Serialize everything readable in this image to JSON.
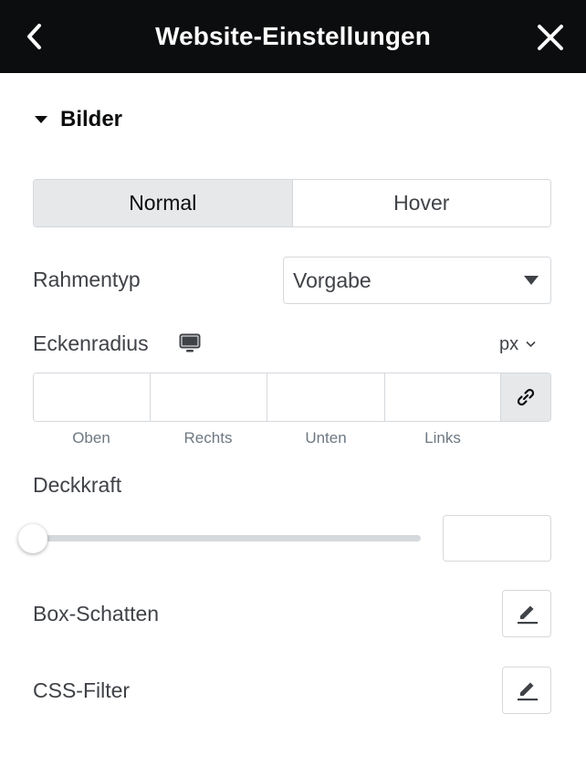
{
  "header": {
    "title": "Website-Einstellungen",
    "back_icon": "chevron-left-icon",
    "close_icon": "close-icon"
  },
  "section": {
    "title": "Bilder",
    "expanded": true
  },
  "tabs": [
    {
      "label": "Normal",
      "active": true
    },
    {
      "label": "Hover",
      "active": false
    }
  ],
  "border_type": {
    "label": "Rahmentyp",
    "value": "Vorgabe"
  },
  "corner_radius": {
    "label": "Eckenradius",
    "device_icon": "desktop-monitor-icon",
    "unit": "px",
    "fields": [
      {
        "label": "Oben",
        "value": ""
      },
      {
        "label": "Rechts",
        "value": ""
      },
      {
        "label": "Unten",
        "value": ""
      },
      {
        "label": "Links",
        "value": ""
      }
    ],
    "link_icon": "link-icon"
  },
  "opacity": {
    "label": "Deckkraft",
    "value": "",
    "slider_level": 0
  },
  "box_shadow": {
    "label": "Box-Schatten",
    "icon": "pencil-icon"
  },
  "css_filter": {
    "label": "CSS-Filter",
    "icon": "pencil-icon"
  },
  "colors": {
    "header_bg": "#0c0d0e",
    "active_tab_bg": "#e6e8ea",
    "border": "#d5d8dc",
    "text": "#3f4247"
  }
}
